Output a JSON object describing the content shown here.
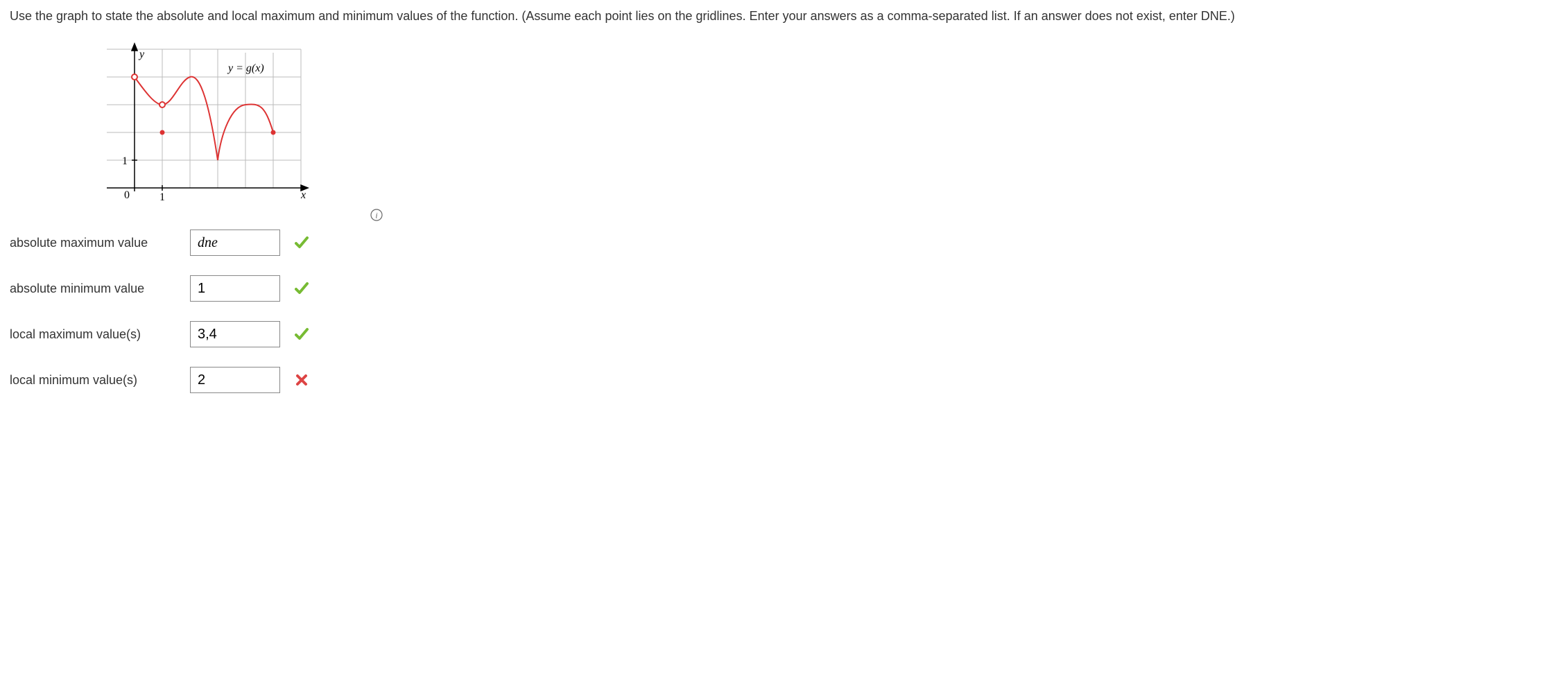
{
  "question": "Use the graph to state the absolute and local maximum and minimum values of the function. (Assume each point lies on the gridlines. Enter your answers as a comma-separated list. If an answer does not exist, enter DNE.)",
  "graph": {
    "ylabel": "y",
    "xlabel": "x",
    "origin_label": "0",
    "xtick_label": "1",
    "ytick_label": "1",
    "curve_label": "y = g(x)"
  },
  "chart_data": {
    "type": "line",
    "xlim": [
      -1,
      5
    ],
    "ylim": [
      0,
      4
    ],
    "curve_points": [
      {
        "x": 0,
        "y": 4,
        "endpoint": "open"
      },
      {
        "x": 1,
        "y": 3,
        "hole": true,
        "hole_value": 2
      },
      {
        "x": 2,
        "y": 4
      },
      {
        "x": 3,
        "y": 1
      },
      {
        "x": 4,
        "y": 3
      },
      {
        "x": 5,
        "y": 2,
        "endpoint": "closed"
      }
    ],
    "title": "",
    "xlabel": "x",
    "ylabel": "y"
  },
  "answers": [
    {
      "label": "absolute maximum value",
      "value": "dne",
      "status": "correct",
      "italic": true
    },
    {
      "label": "absolute minimum value",
      "value": "1",
      "status": "correct",
      "italic": false
    },
    {
      "label": "local maximum value(s)",
      "value": "3,4",
      "status": "correct",
      "italic": false
    },
    {
      "label": "local minimum value(s)",
      "value": "2",
      "status": "incorrect",
      "italic": false
    }
  ]
}
